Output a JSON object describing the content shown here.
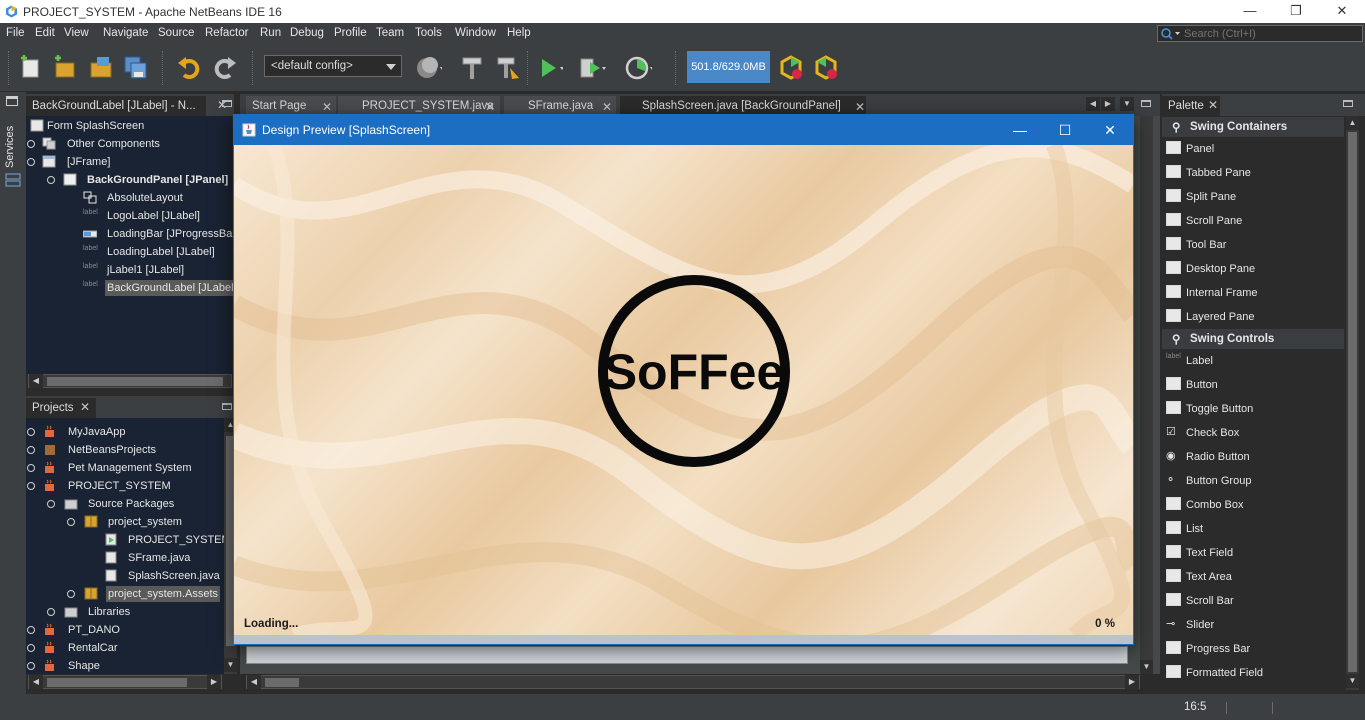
{
  "window": {
    "title": "PROJECT_SYSTEM - Apache NetBeans IDE 16",
    "min_glyph": "—",
    "max_glyph": "❐",
    "close_glyph": "✕"
  },
  "menu": [
    "File",
    "Edit",
    "View",
    "Navigate",
    "Source",
    "Refactor",
    "Run",
    "Debug",
    "Profile",
    "Team",
    "Tools",
    "Window",
    "Help"
  ],
  "search": {
    "placeholder": "Search (Ctrl+I)"
  },
  "toolbar": {
    "config": "<default config>",
    "memory": "501.8/629.0MB"
  },
  "sidebar_strip": {
    "services": "Services"
  },
  "navigator": {
    "tab": "BackGroundLabel [JLabel] - N...",
    "rows": [
      {
        "label": "Form SplashScreen",
        "icon": "form-icon"
      },
      {
        "label": "Other Components",
        "icon": "components-icon"
      },
      {
        "label": "[JFrame]",
        "icon": "frame-icon"
      },
      {
        "label": "BackGroundPanel [JPanel]",
        "icon": "panel-icon"
      },
      {
        "label": "AbsoluteLayout",
        "icon": "layout-icon"
      },
      {
        "label": "LogoLabel [JLabel]",
        "icon": "label-icon"
      },
      {
        "label": "LoadingBar [JProgressBar]",
        "icon": "progressbar-icon"
      },
      {
        "label": "LoadingLabel [JLabel]",
        "icon": "label-icon"
      },
      {
        "label": "jLabel1 [JLabel]",
        "icon": "label-icon"
      },
      {
        "label": "BackGroundLabel [JLabel]",
        "icon": "label-icon"
      }
    ]
  },
  "projects": {
    "tab": "Projects",
    "rows": [
      {
        "label": "MyJavaApp",
        "icon": "java-project-icon"
      },
      {
        "label": "NetBeansProjects",
        "icon": "java-project-icon"
      },
      {
        "label": "Pet Management System",
        "icon": "java-project-icon"
      },
      {
        "label": "PROJECT_SYSTEM",
        "icon": "java-project-icon"
      },
      {
        "label": "Source Packages",
        "icon": "source-packages-icon"
      },
      {
        "label": "project_system",
        "icon": "package-icon"
      },
      {
        "label": "PROJECT_SYSTEM.java",
        "icon": "java-file-icon"
      },
      {
        "label": "SFrame.java",
        "icon": "java-file-icon"
      },
      {
        "label": "SplashScreen.java",
        "icon": "java-file-icon"
      },
      {
        "label": "project_system.Assets",
        "icon": "package-icon"
      },
      {
        "label": "Libraries",
        "icon": "libraries-icon"
      },
      {
        "label": "PT_DANO",
        "icon": "java-project-icon"
      },
      {
        "label": "RentalCar",
        "icon": "java-project-icon"
      },
      {
        "label": "Shape",
        "icon": "java-project-icon"
      }
    ]
  },
  "editor_tabs": [
    {
      "label": "Start Page"
    },
    {
      "label": "PROJECT_SYSTEM.java"
    },
    {
      "label": "SFrame.java"
    },
    {
      "label": "SplashScreen.java [BackGroundPanel]"
    }
  ],
  "dialog": {
    "title": "Design Preview [SplashScreen]",
    "loading": "Loading...",
    "percent": "0 %",
    "progress": 0,
    "logo_text": "SoFFee"
  },
  "palette": {
    "tab": "Palette",
    "categories": [
      {
        "name": "Swing Containers",
        "items": [
          "Panel",
          "Tabbed Pane",
          "Split Pane",
          "Scroll Pane",
          "Tool Bar",
          "Desktop Pane",
          "Internal Frame",
          "Layered Pane"
        ]
      },
      {
        "name": "Swing Controls",
        "items": [
          "Label",
          "Button",
          "Toggle Button",
          "Check Box",
          "Radio Button",
          "Button Group",
          "Combo Box",
          "List",
          "Text Field",
          "Text Area",
          "Scroll Bar",
          "Slider",
          "Progress Bar",
          "Formatted Field"
        ]
      }
    ]
  },
  "status": {
    "position": "16:5"
  },
  "colors": {
    "dialog_accent": "#1b6ec2",
    "memory_bar": "#4a88c7",
    "tree_bg": "#1a2333",
    "chrome": "#3c3f41"
  }
}
